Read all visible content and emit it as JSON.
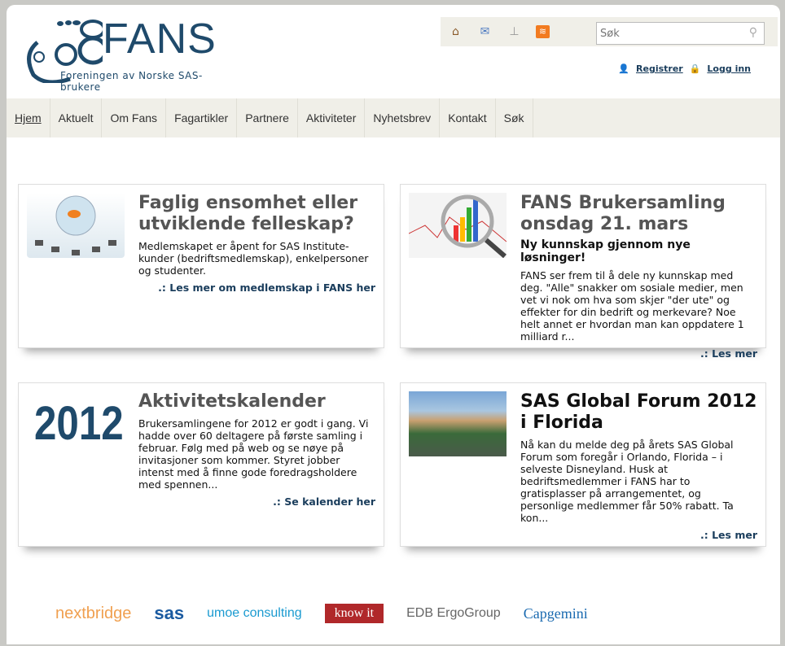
{
  "logo": {
    "name": "FANS",
    "subtitle": "Foreningen av Norske SAS-brukere"
  },
  "toolbar": {
    "icons": [
      "home-icon",
      "mail-icon",
      "sitemap-icon",
      "rss-icon"
    ],
    "search_placeholder": "Søk"
  },
  "user": {
    "register": "Registrer",
    "login": "Logg inn"
  },
  "nav": [
    "Hjem",
    "Aktuelt",
    "Om Fans",
    "Fagartikler",
    "Partnere",
    "Aktiviteter",
    "Nyhetsbrev",
    "Kontakt",
    "Søk"
  ],
  "cards": [
    {
      "title": "Faglig ensomhet eller utviklende felleskap?",
      "subtitle": "",
      "text": "Medlemskapet er åpent for SAS Institute-kunder (bedriftsmedlemskap), enkelpersoner og studenter.",
      "link": ".: Les mer om medlemskap i FANS her"
    },
    {
      "title": "FANS Brukersamling onsdag 21. mars",
      "subtitle": "Ny kunnskap gjennom nye løsninger!",
      "text": "FANS ser frem til å dele ny kunnskap med deg. \"Alle\" snakker om sosiale medier, men vet vi nok om hva som skjer \"der ute\" og effekter for din bedrift og merkevare? Noe helt annet er hvordan man kan oppdatere 1 milliard r...",
      "link": ".: Les mer"
    },
    {
      "title": "Aktivitetskalender",
      "subtitle": "",
      "image_text": "2012",
      "text": "Brukersamlingene for 2012 er godt i gang. Vi hadde over 60 deltagere på første samling i februar. Følg med på web og se nøye på invitasjoner som kommer. Styret jobber intenst med å finne gode foredragsholdere med spennen...",
      "link": ".: Se kalender her"
    },
    {
      "title": "SAS Global Forum 2012 i Florida",
      "subtitle": "",
      "text": "Nå kan du melde deg på årets SAS Global Forum som foregår i Orlando, Florida – i selveste Disneyland. Husk at bedriftsmedlemmer i FANS har to gratisplasser på arrangementet, og personlige medlemmer får 50% rabatt. Ta kon...",
      "link": ".: Les mer"
    }
  ],
  "partners": [
    "nextbridge",
    "sas",
    "umoe consulting",
    "know it",
    "EDB ErgoGroup",
    "Capgemini"
  ],
  "colors": {
    "brand": "#1f4a6b",
    "nav_bg": "#f0efe8",
    "link": "#1a3d5c",
    "knowit": "#b0282a"
  }
}
